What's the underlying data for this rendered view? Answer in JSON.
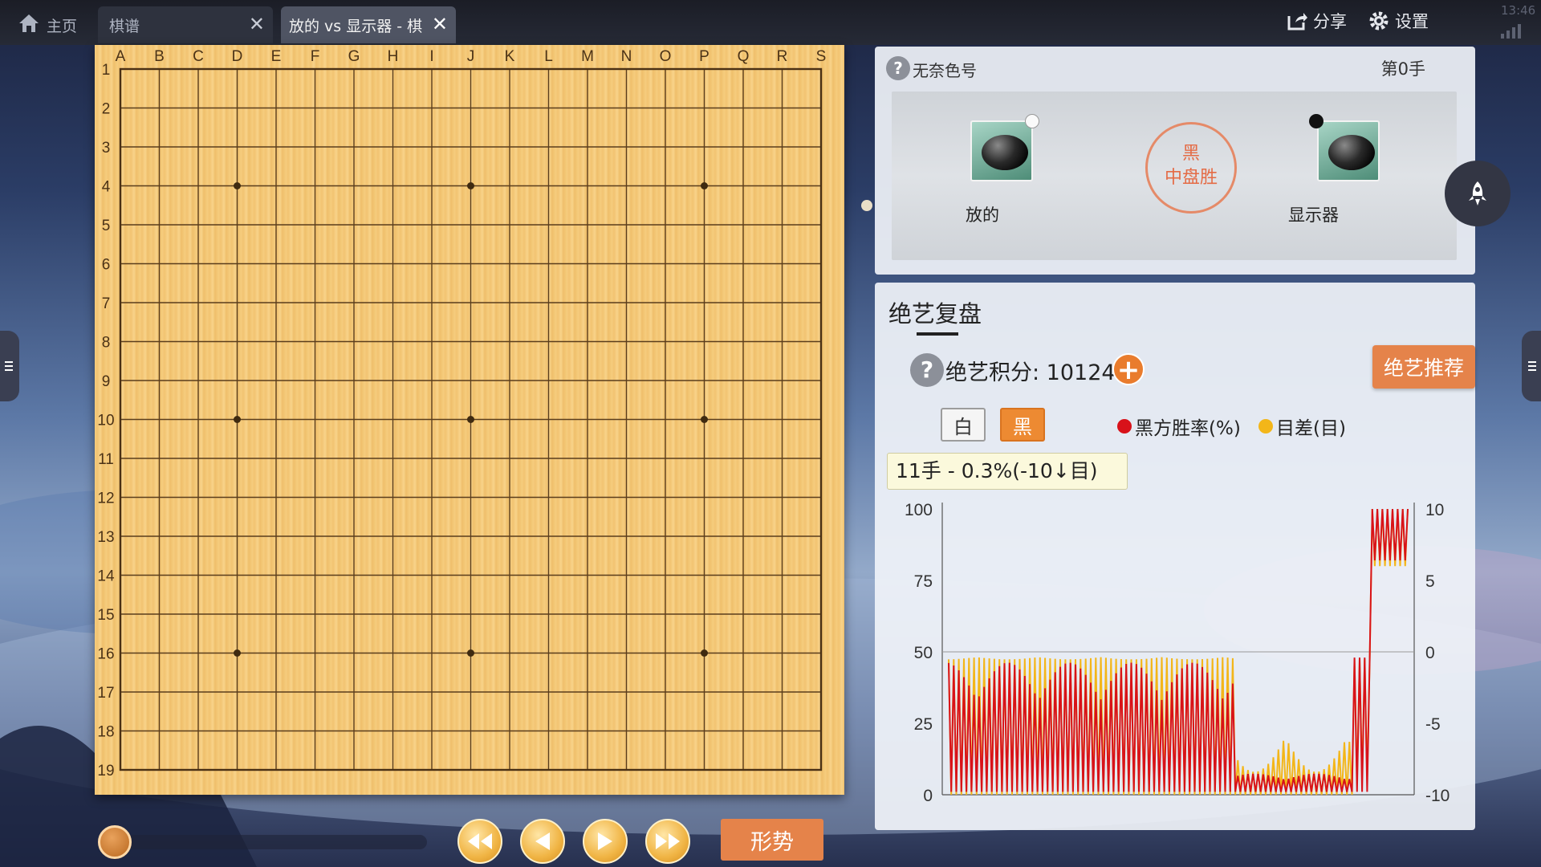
{
  "tabs": [
    {
      "label": "主页",
      "icon": "home-icon"
    },
    {
      "label": "棋谱",
      "close": "✕"
    },
    {
      "label": "放的 vs 显示器 - 棋",
      "close": "✕"
    }
  ],
  "toolbar": {
    "share_label": "分享",
    "settings_label": "设置",
    "time": "13:46"
  },
  "board": {
    "columns": [
      "A",
      "B",
      "C",
      "D",
      "E",
      "F",
      "G",
      "H",
      "I",
      "J",
      "K",
      "L",
      "M",
      "N",
      "O",
      "P",
      "Q",
      "R",
      "S"
    ],
    "rows": [
      "1",
      "2",
      "3",
      "4",
      "5",
      "6",
      "7",
      "8",
      "9",
      "10",
      "11",
      "12",
      "13",
      "14",
      "15",
      "16",
      "17",
      "18",
      "19"
    ]
  },
  "game_info": {
    "rule_name": "无奈色号",
    "move_count": "第0手",
    "black_player": "放的",
    "white_player": "显示器",
    "result_line1": "黑",
    "result_line2": "中盘胜"
  },
  "analysis": {
    "title": "绝艺复盘",
    "score_label": "绝艺积分: 10124",
    "plus": "+",
    "recommend_label": "绝艺推荐",
    "toggle_white": "白",
    "toggle_black": "黑",
    "legend_winrate": "黑方胜率(%)",
    "legend_diff": "目差(目)",
    "tooltip": "11手 - 0.3%(-10↓目)",
    "winrate_color": "#d8121a",
    "diff_color": "#f3b619"
  },
  "chart_data": {
    "type": "line",
    "y_left_ticks": [
      "100",
      "75",
      "50",
      "25",
      "0"
    ],
    "y_right_ticks": [
      "10",
      "5",
      "0",
      "-5",
      "-10"
    ],
    "ylim_left": [
      0,
      100
    ],
    "ylim_right": [
      -10,
      10
    ],
    "series": [
      {
        "name": "黑方胜率(%)",
        "color": "#d8121a",
        "segments": [
          {
            "from": 1,
            "to": 114,
            "peak": 44,
            "trough": 1
          },
          {
            "from": 115,
            "to": 160,
            "peak": 7,
            "trough": 1
          },
          {
            "from": 161,
            "to": 167,
            "peak": 48,
            "trough": 1
          },
          {
            "from": 168,
            "to": 182,
            "peak": 100,
            "trough": 82
          }
        ]
      },
      {
        "name": "目差(目)",
        "color": "#f3b619",
        "segments": [
          {
            "from": 1,
            "to": 114,
            "peak": -0.5,
            "trough": -10
          },
          {
            "from": 115,
            "to": 160,
            "peak": -8,
            "trough": -10
          },
          {
            "from": 161,
            "to": 167,
            "peak": -0.5,
            "trough": -9
          },
          {
            "from": 168,
            "to": 182,
            "peak": 10,
            "trough": 6
          }
        ]
      }
    ],
    "x_range": [
      1,
      182
    ],
    "gridline_at": 50
  },
  "controls": {
    "situation_label": "形势"
  }
}
